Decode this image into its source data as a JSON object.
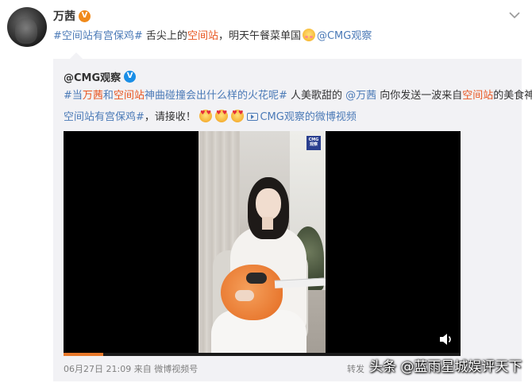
{
  "post": {
    "author": "万茜",
    "text_line": [
      {
        "t": "#空间站有宫保鸡#",
        "c": "link"
      },
      {
        "t": " 舌尖上的",
        "c": ""
      },
      {
        "t": "空间站",
        "c": "hl"
      },
      {
        "t": "，明天午餐菜单国",
        "c": ""
      },
      {
        "t": "@CMG观察",
        "c": "link"
      }
    ]
  },
  "repost": {
    "author": "@CMG观察",
    "line1": [
      {
        "t": "#当",
        "c": "link"
      },
      {
        "t": "万茜",
        "c": "hl"
      },
      {
        "t": "和",
        "c": "link"
      },
      {
        "t": "空间站",
        "c": "hl"
      },
      {
        "t": "神曲碰撞会出什么样的火花呢#",
        "c": "link"
      },
      {
        "t": " 人美歌甜的 ",
        "c": ""
      },
      {
        "t": "@万茜",
        "c": "link"
      },
      {
        "t": " 向你发送一波来自",
        "c": ""
      },
      {
        "t": "空间站",
        "c": "hl"
      },
      {
        "t": "的美食神曲",
        "c": ""
      },
      {
        "t": "#",
        "c": "link"
      }
    ],
    "line2_hashtag": "空间站有宫保鸡#",
    "line2_text": "，请接收！",
    "video_link_text": "CMG观察的微博视频",
    "video": {
      "badge_line1": "CMG",
      "badge_line2": "观察",
      "progress": 0.1
    },
    "timestamp": "06月27日 21:09",
    "source_prefix": "来自",
    "source": "微博视频号",
    "repost_label": "转发"
  },
  "watermark": "头条 @蓝雨星城娱评天下",
  "colors": {
    "link": "#4b7ab7",
    "highlight": "#e8541e",
    "verified_orange": "#f08a1b",
    "verified_blue": "#1a8ee6",
    "repost_bg": "#f2f2f5",
    "progress": "#e8782a"
  },
  "icons": [
    "avatar",
    "verified-badge-icon",
    "chevron-down-icon",
    "blush-emoji-icon",
    "heart-eyes-emoji-icon",
    "video-link-icon",
    "volume-icon"
  ]
}
